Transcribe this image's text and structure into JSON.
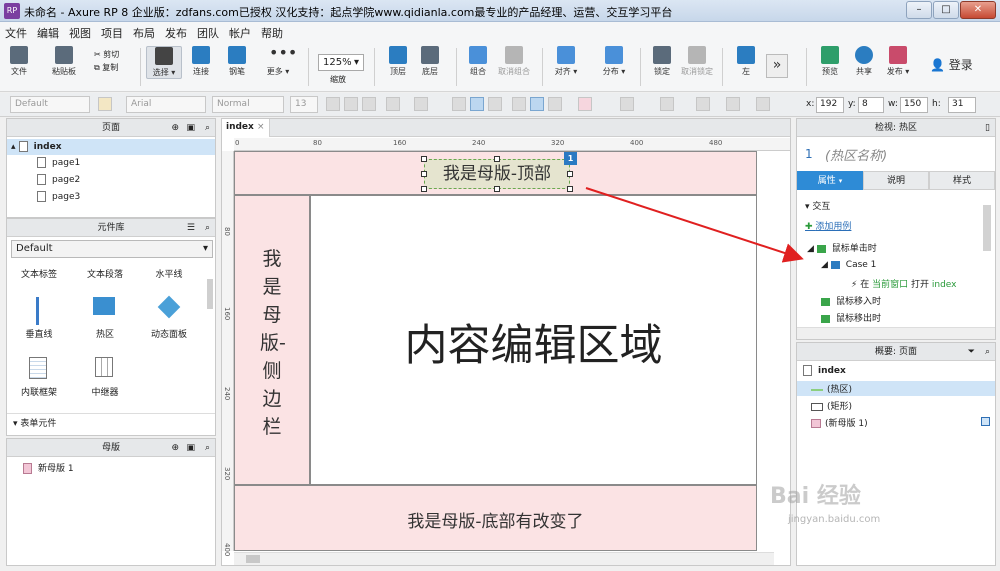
{
  "window": {
    "title": "未命名 - Axure RP 8 企业版：zdfans.com已授权 汉化支持：起点学院www.qidianla.com最专业的产品经理、运营、交互学习平台",
    "app_icon": "RP"
  },
  "menu": [
    "文件",
    "编辑",
    "视图",
    "项目",
    "布局",
    "发布",
    "团队",
    "帐户",
    "帮助"
  ],
  "toolbar": {
    "file": "文件",
    "paste": "粘贴板",
    "cut": "剪切",
    "copy": "复制",
    "select": "选择",
    "connect": "连接",
    "pen": "钢笔",
    "more": "更多",
    "zoom_value": "125%",
    "zoom_label": "缩放",
    "top": "顶层",
    "bottom": "底层",
    "group": "组合",
    "ungroup": "取消组合",
    "align": "对齐",
    "distribute": "分布",
    "lock": "锁定",
    "unlock": "取消锁定",
    "left": "左",
    "preview": "预览",
    "share": "共享",
    "publish": "发布",
    "login": "登录"
  },
  "format_bar": {
    "style": "Default",
    "font": "Arial",
    "weight": "Normal",
    "size": "13",
    "x_label": "x:",
    "x": "192",
    "y_label": "y:",
    "y": "8",
    "w_label": "w:",
    "w": "150",
    "h_label": "h:",
    "h": "31"
  },
  "pages_panel": {
    "title": "页面",
    "items": [
      {
        "label": "index"
      },
      {
        "label": "page1"
      },
      {
        "label": "page2"
      },
      {
        "label": "page3"
      }
    ]
  },
  "widgets_panel": {
    "title": "元件库",
    "library": "Default",
    "items": [
      "文本标签",
      "文本段落",
      "水平线",
      "垂直线",
      "热区",
      "动态面板",
      "内联框架",
      "中继器"
    ],
    "section": "表单元件"
  },
  "masters_panel": {
    "title": "母版",
    "items": [
      "新母版 1"
    ]
  },
  "canvas": {
    "tab": "index",
    "ruler_h": [
      "0",
      "80",
      "160",
      "240",
      "320",
      "400",
      "480"
    ],
    "ruler_v": [
      "80",
      "160",
      "240",
      "320",
      "400"
    ],
    "header_text": "我是母版-顶部",
    "sidebar_text": "我是母版-侧边栏",
    "content_text": "内容编辑区域",
    "footer_text": "我是母版-底部有改变了",
    "badge": "1"
  },
  "inspector": {
    "title": "检视: 热区",
    "number": "1",
    "name_placeholder": "(热区名称)",
    "tabs": [
      "属性",
      "说明",
      "样式"
    ],
    "section": "交互",
    "add_case": "添加用例",
    "onclick": "鼠标单击时",
    "case": "Case 1",
    "action_prefix": "在",
    "action_target": "当前窗口",
    "action_verb": "打开",
    "action_page": "index",
    "mouse_enter": "鼠标移入时",
    "mouse_leave": "鼠标移出时"
  },
  "outline": {
    "title": "概要: 页面",
    "root": "index",
    "items": [
      "(热区)",
      "(矩形)",
      "(新母版 1)"
    ]
  },
  "watermark": {
    "brand": "Bai 经验",
    "url": "jingyan.baidu.com"
  },
  "colors": {
    "accent": "#2e8bd6",
    "master_fill": "#fbe3e4",
    "arrow": "#e02020",
    "action_green": "#2a9a3a"
  }
}
